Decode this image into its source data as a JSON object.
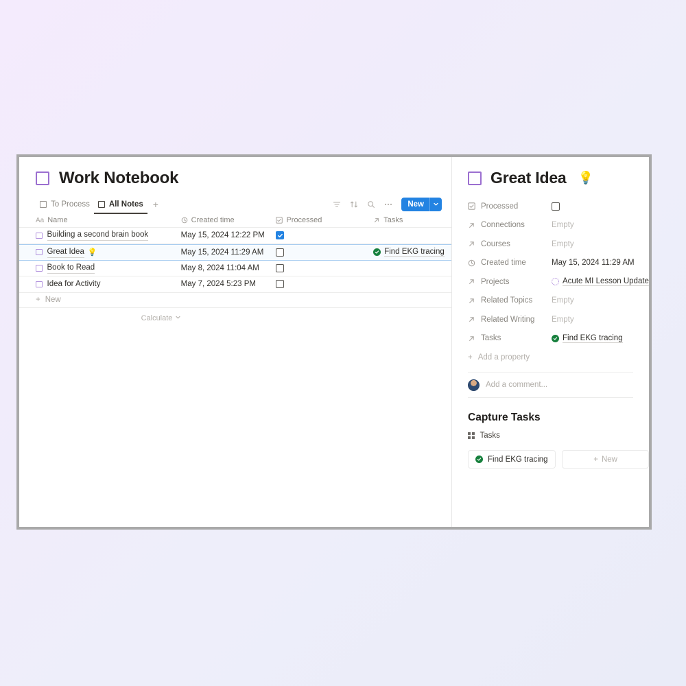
{
  "window": {
    "left_pane": {
      "page_title": "Work Notebook",
      "page_icon": "square-outline-icon",
      "tabs": [
        {
          "label": "To Process",
          "active": false
        },
        {
          "label": "All Notes",
          "active": true
        }
      ],
      "add_tab_label": "+",
      "toolbar": {
        "filter_icon": "filter-icon",
        "sort_icon": "sort-icon",
        "search_icon": "search-icon",
        "more_icon": "more-horizontal-icon",
        "new_label": "New",
        "new_dropdown_icon": "chevron-down-icon",
        "new_button_color": "#2383e2"
      },
      "table": {
        "columns": [
          {
            "label": "Name",
            "icon": "text-property-icon"
          },
          {
            "label": "Created time",
            "icon": "clock-icon"
          },
          {
            "label": "Processed",
            "icon": "checkbox-property-icon"
          },
          {
            "label": "Tasks",
            "icon": "relation-arrow-icon"
          }
        ],
        "rows": [
          {
            "name": "Building a second brain book",
            "emoji": "",
            "created": "May 15, 2024 12:22 PM",
            "processed": true,
            "task": "",
            "selected": false
          },
          {
            "name": "Great Idea",
            "emoji": "💡",
            "created": "May 15, 2024 11:29 AM",
            "processed": false,
            "task": "Find EKG tracing",
            "selected": true
          },
          {
            "name": "Book to Read",
            "emoji": "",
            "created": "May 8, 2024 11:04 AM",
            "processed": false,
            "task": "",
            "selected": false
          },
          {
            "name": "Idea for Activity",
            "emoji": "",
            "created": "May 7, 2024 5:23 PM",
            "processed": false,
            "task": "",
            "selected": false
          }
        ],
        "new_row_label": "New",
        "calculate_label": "Calculate"
      }
    },
    "right_pane": {
      "page_title": "Great Idea",
      "page_emoji": "💡",
      "page_icon": "square-outline-icon",
      "properties": [
        {
          "label": "Processed",
          "icon": "checkbox-property-icon",
          "type": "checkbox",
          "checked": false
        },
        {
          "label": "Connections",
          "icon": "relation-arrow-icon",
          "type": "text",
          "value": "Empty",
          "empty": true
        },
        {
          "label": "Courses",
          "icon": "relation-arrow-icon",
          "type": "text",
          "value": "Empty",
          "empty": true
        },
        {
          "label": "Created time",
          "icon": "clock-icon",
          "type": "text",
          "value": "May 15, 2024 11:29 AM",
          "empty": false
        },
        {
          "label": "Projects",
          "icon": "relation-arrow-icon",
          "type": "link-dotted",
          "value": "Acute MI Lesson Update",
          "empty": false
        },
        {
          "label": "Related Topics",
          "icon": "relation-arrow-icon",
          "type": "text",
          "value": "Empty",
          "empty": true
        },
        {
          "label": "Related Writing",
          "icon": "relation-arrow-icon",
          "type": "text",
          "value": "Empty",
          "empty": true
        },
        {
          "label": "Tasks",
          "icon": "relation-arrow-icon",
          "type": "link-check",
          "value": "Find EKG tracing",
          "empty": false
        }
      ],
      "add_property_label": "Add a property",
      "comment_placeholder": "Add a comment...",
      "avatar": "user-avatar",
      "capture_heading": "Capture Tasks",
      "tasks_db_label": "Tasks",
      "task_cards": [
        {
          "label": "Find EKG tracing",
          "status": "done"
        }
      ],
      "new_card_label": "New"
    }
  }
}
